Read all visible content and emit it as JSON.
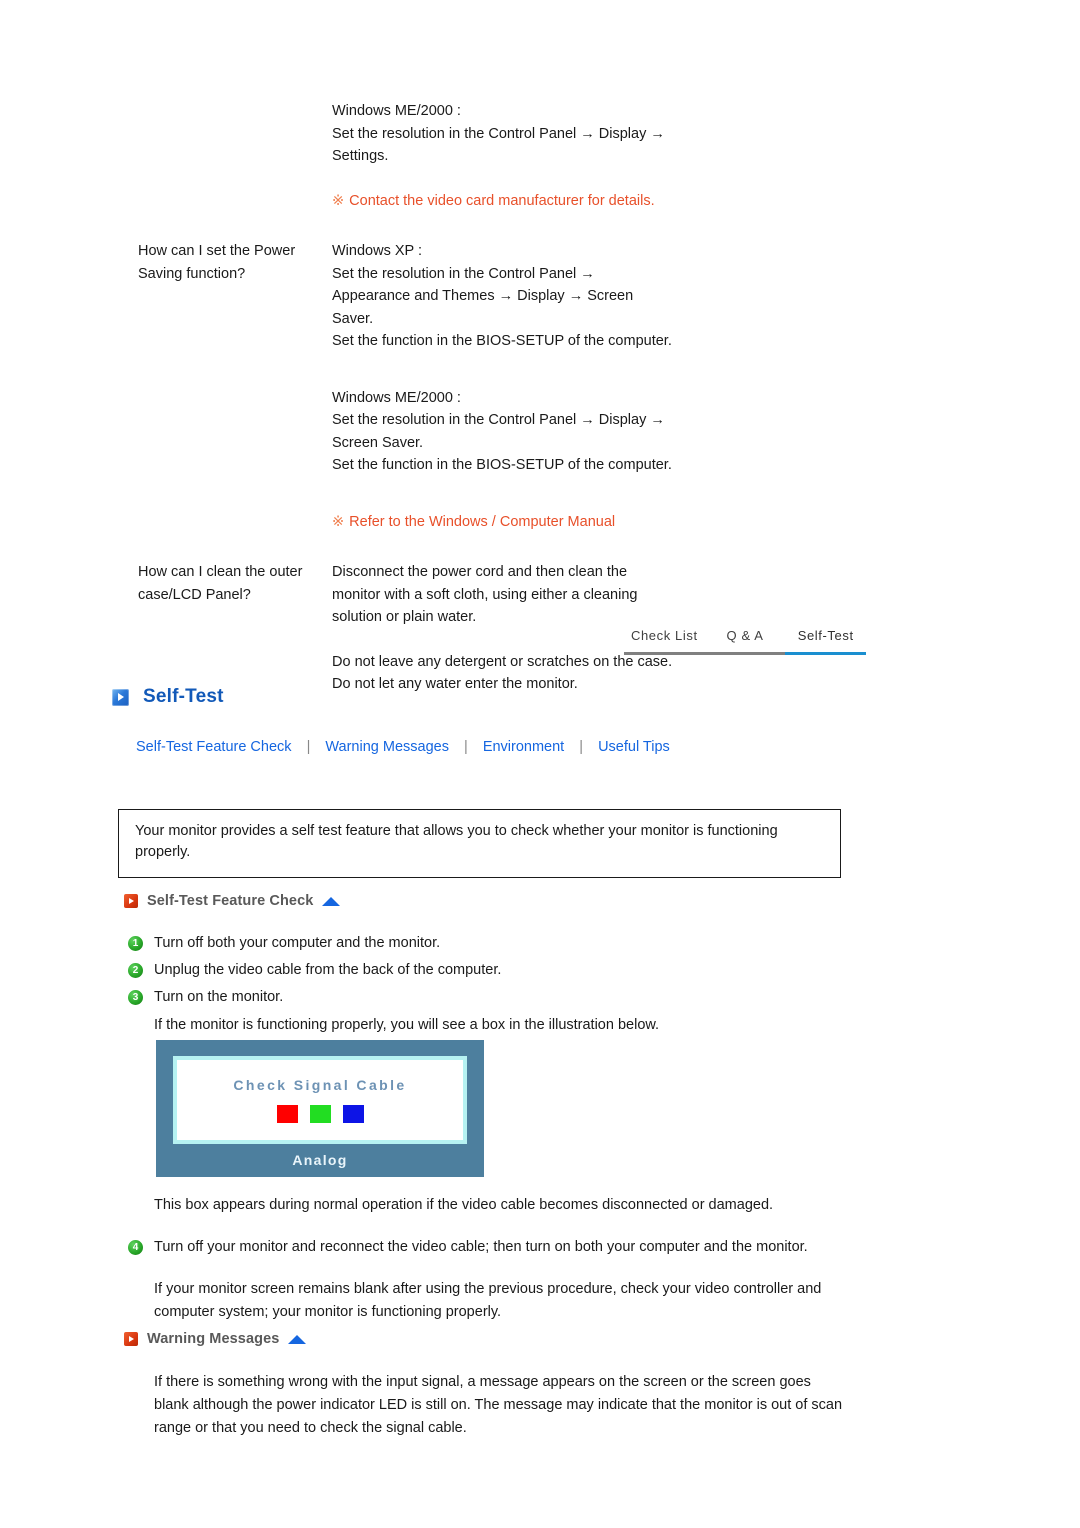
{
  "faq": {
    "rows": [
      {
        "question": "",
        "answer_lines": [
          "Windows ME/2000 :",
          "Set the resolution in the Control Panel → Display →",
          "Settings."
        ],
        "note": "Contact the video card manufacturer for details.",
        "note_mark": "※"
      },
      {
        "question": "How can I set the Power Saving function?",
        "answer_lines": [
          "Windows XP :",
          "Set the resolution in the Control Panel →",
          "Appearance and Themes → Display → Screen",
          "Saver.",
          "Set the function in the BIOS-SETUP of the computer."
        ],
        "answer_lines2": [
          "Windows ME/2000 :",
          "Set the resolution in the Control Panel → Display →",
          "Screen Saver.",
          "Set the function in the BIOS-SETUP of the computer."
        ],
        "note": "Refer to the Windows / Computer Manual",
        "note_mark": "※"
      },
      {
        "question": "How can I clean the outer case/LCD Panel?",
        "answer_lines": [
          "Disconnect the power cord and then clean the",
          "monitor with a soft cloth, using either a cleaning",
          "solution or plain water."
        ],
        "answer_lines2": [
          "Do not leave any detergent or scratches on the case.",
          "Do not let any water enter the monitor."
        ]
      }
    ]
  },
  "tabs": [
    {
      "label": "Check List",
      "active": false
    },
    {
      "label": "Q & A",
      "active": false
    },
    {
      "label": "Self-Test",
      "active": true
    }
  ],
  "section": {
    "title": "Self-Test",
    "links": [
      "Self-Test Feature Check",
      "Warning Messages",
      "Environment",
      "Useful Tips"
    ],
    "separator": "|",
    "intro": "Your monitor provides a self test feature that allows you to check whether your monitor is functioning properly."
  },
  "feature_check": {
    "heading": "Self-Test Feature Check",
    "steps": [
      {
        "num": "❶",
        "text": "Turn off both your computer and the monitor."
      },
      {
        "num": "❷",
        "text": "Unplug the video cable from the back of the computer."
      },
      {
        "num": "❸",
        "text": "Turn on the monitor."
      }
    ],
    "after_steps": "If the monitor is functioning properly, you will see a box in the illustration below.",
    "caption": "This box appears during normal operation if the video cable becomes disconnected or damaged.",
    "step4_num": "❹",
    "step4_text": "Turn off your monitor and reconnect the video cable; then turn on both your computer and the monitor.",
    "closing": "If your monitor screen remains blank after using the previous procedure, check your video controller and computer system; your monitor is functioning properly."
  },
  "monitor_box": {
    "screen_title": "Check Signal Cable",
    "label": "Analog",
    "swatches": [
      {
        "name": "red-swatch",
        "color": "#ff0000"
      },
      {
        "name": "green-swatch",
        "color": "#22dd22"
      },
      {
        "name": "blue-swatch",
        "color": "#0d14e6"
      }
    ],
    "frame_color": "#4d7f9e",
    "inner_border_color": "#b6f2f2"
  },
  "warning_messages": {
    "heading": "Warning Messages",
    "body": "If there is something wrong with the input signal, a message appears on the screen or the screen goes blank although the power indicator LED is still on. The message may indicate that the monitor is out of scan range or that you need to check the signal cable."
  },
  "colors": {
    "link_blue": "#1566e0",
    "heading_blue": "#1259b8",
    "active_tab_blue": "#1a8fd0",
    "note_orange": "#e8502a",
    "subhead_gray": "#595959"
  }
}
